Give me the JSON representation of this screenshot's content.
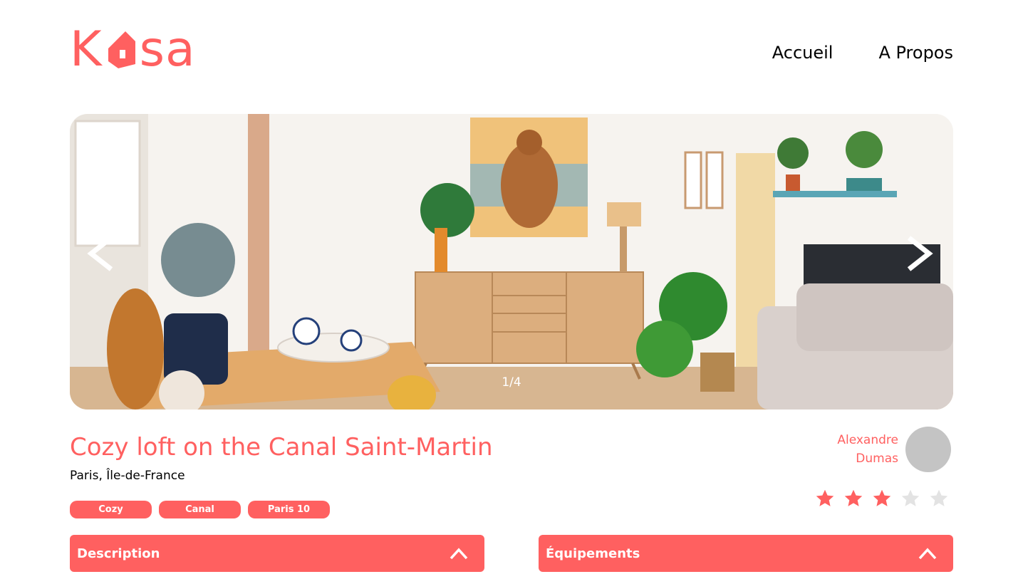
{
  "brand": {
    "logo_left": "K",
    "logo_right": "sa",
    "color": "#FF6060"
  },
  "nav": {
    "items": [
      {
        "label": "Accueil"
      },
      {
        "label": "A Propos"
      }
    ]
  },
  "gallery": {
    "counter": "1/4",
    "prev_icon": "chevron-left-icon",
    "next_icon": "chevron-right-icon"
  },
  "listing": {
    "title": "Cozy loft on the Canal Saint-Martin",
    "location": "Paris, Île-de-France",
    "tags": [
      "Cozy",
      "Canal",
      "Paris 10"
    ],
    "host": {
      "first_name": "Alexandre",
      "last_name": "Dumas"
    },
    "rating": 3,
    "rating_max": 5
  },
  "collapses": [
    {
      "label": "Description",
      "icon": "chevron-up-icon"
    },
    {
      "label": "Équipements",
      "icon": "chevron-up-icon"
    }
  ],
  "colors": {
    "accent": "#FF6060",
    "star_empty": "#E3E3E3",
    "avatar": "#C4C4C4"
  }
}
